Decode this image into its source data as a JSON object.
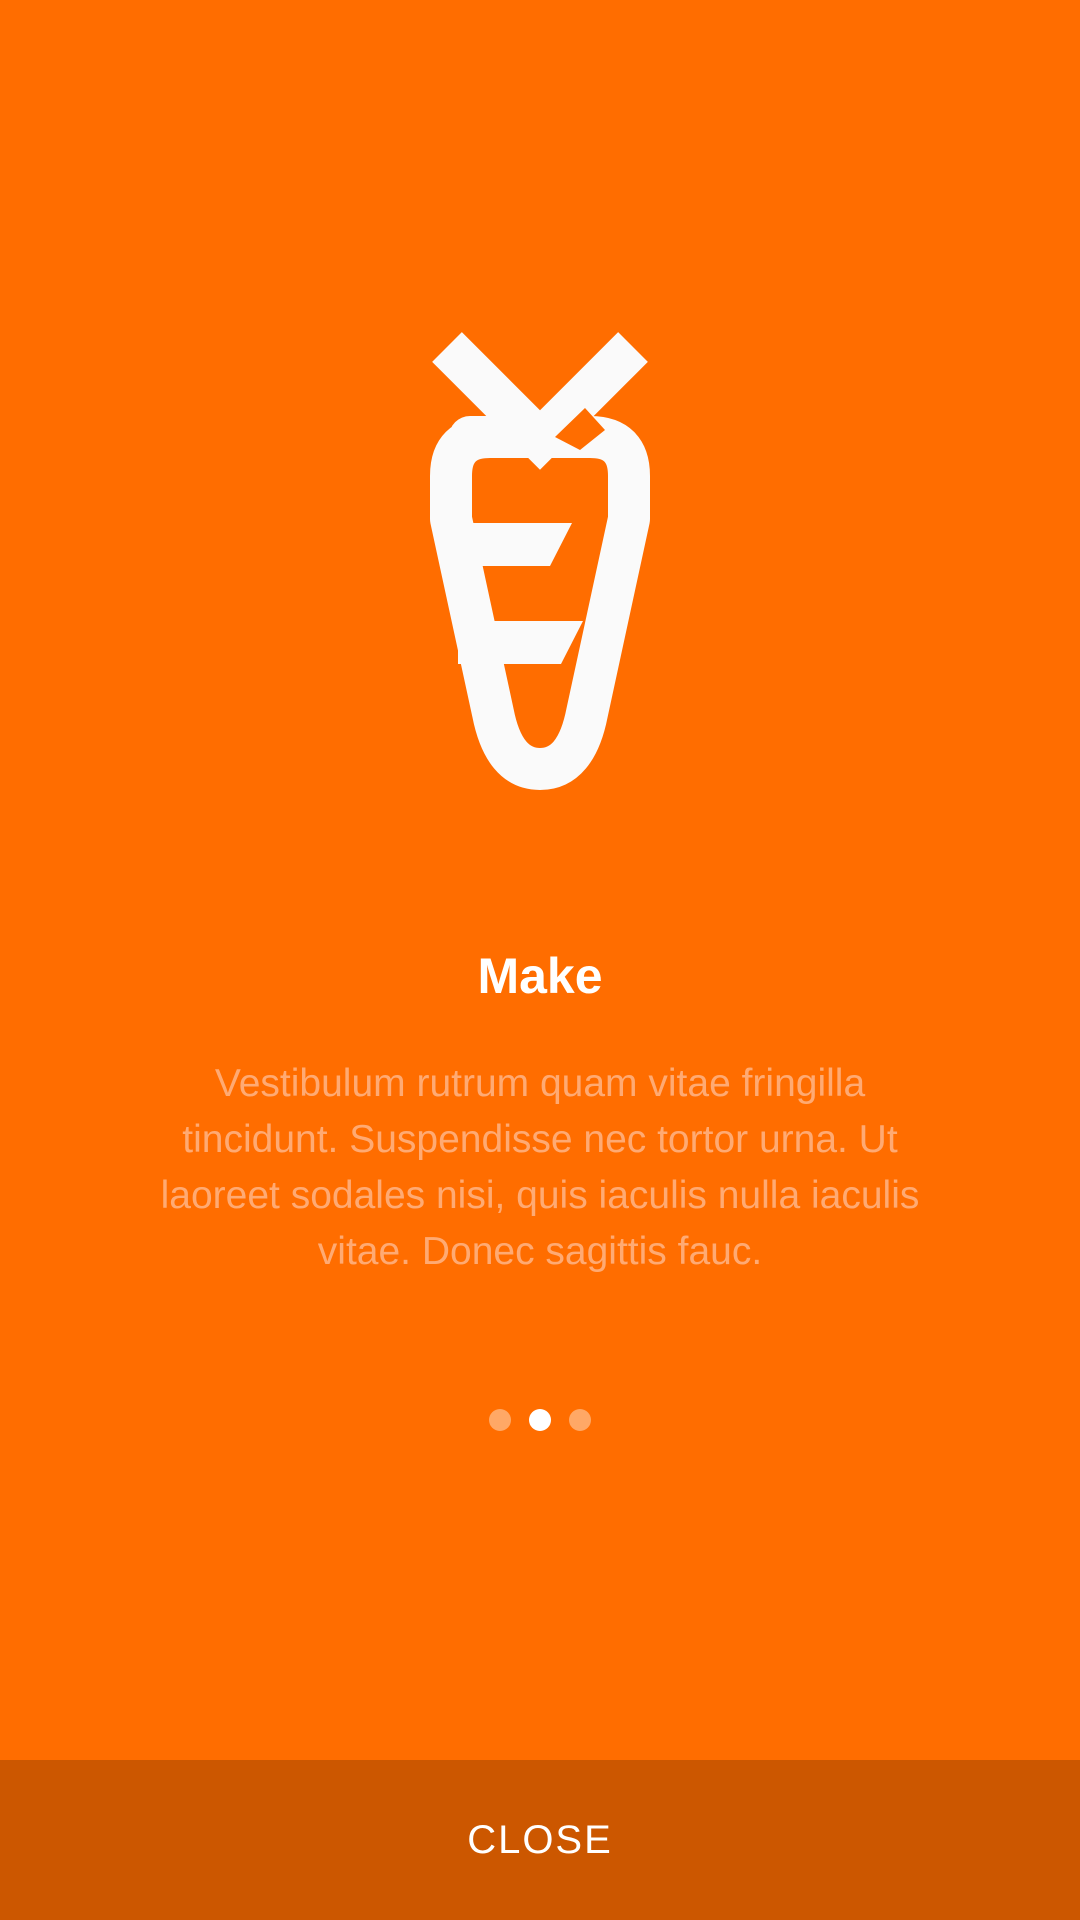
{
  "onboarding": {
    "illustration_icon": "carrot-icon",
    "title": "Make",
    "description": "Vestibulum rutrum quam vitae fringilla tincidunt. Suspendisse nec tortor urna. Ut laoreet sodales nisi, quis iaculis nulla iaculis vitae. Donec sagittis fauc.",
    "pager": {
      "total_pages": 3,
      "current_page": 2
    }
  },
  "footer": {
    "close_label": "CLOSE"
  },
  "colors": {
    "background": "#FF6D00",
    "footer_background": "#CC5700",
    "text_primary": "#FFFFFF",
    "text_secondary": "#FFAA73"
  }
}
